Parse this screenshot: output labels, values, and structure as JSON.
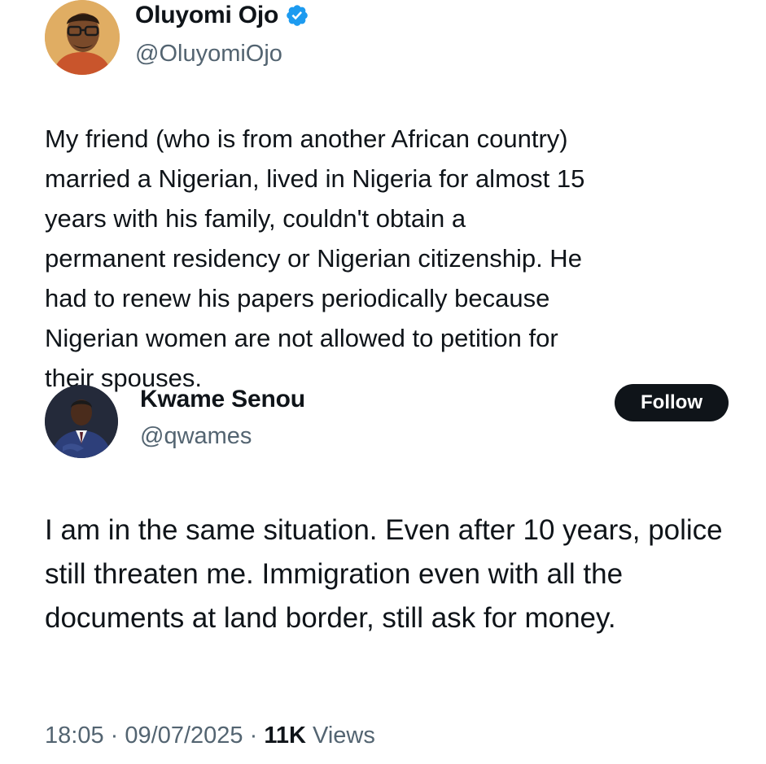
{
  "tweet": {
    "author": {
      "display_name": "Oluyomi Ojo",
      "handle": "@OluyomiOjo",
      "verified": true,
      "avatar_icon": "avatar-photo-man-glasses"
    },
    "text": "My friend (who is from another African country)\nmarried a Nigerian, lived in Nigeria for almost 15\nyears with his family, couldn't obtain a\npermanent residency or Nigerian citizenship. He\nhad to renew his papers periodically because\nNigerian women are not allowed to petition for\ntheir spouses."
  },
  "reply": {
    "author": {
      "display_name": "Kwame Senou",
      "handle": "@qwames",
      "avatar_icon": "avatar-photo-man-suit"
    },
    "follow_label": "Follow",
    "text": "I am in the same situation. Even after 10 years, police still threaten me. Immigration even with all the documents at land border, still ask for money."
  },
  "meta": {
    "time": "18:05",
    "separator": "·",
    "date": "09/07/2025",
    "views_count": "11K",
    "views_label": "Views"
  },
  "colors": {
    "text_primary": "#0f1419",
    "text_secondary": "#536471",
    "verified_blue": "#1d9bf0",
    "follow_bg": "#0f1419"
  }
}
